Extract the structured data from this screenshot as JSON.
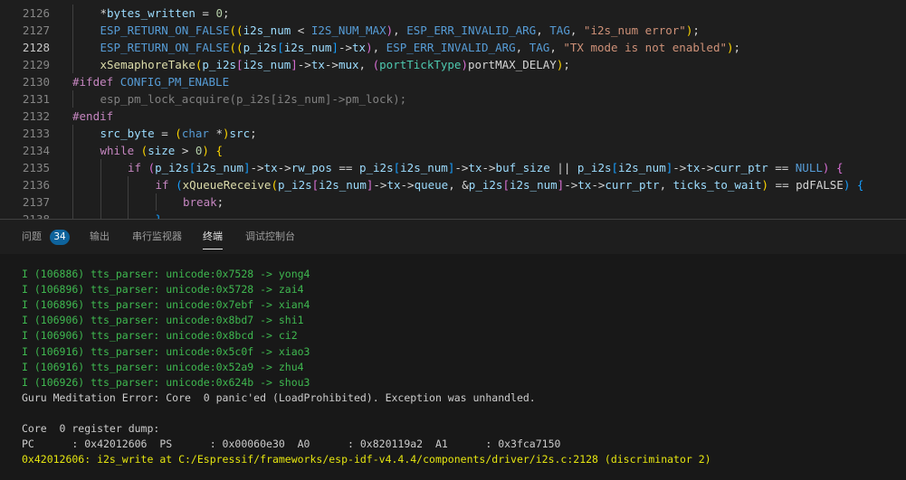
{
  "colors": {
    "background": "#1e1e1e",
    "terminal_background": "#181818",
    "badge": "#0e639c",
    "log_info": "#3fb950",
    "backtrace": "#e5e510"
  },
  "editor": {
    "active_line": "2128",
    "lines": [
      {
        "number": "2126",
        "indent": 1,
        "tokens": [
          {
            "t": "*",
            "c": "txt"
          },
          {
            "t": "bytes_written",
            "c": "var"
          },
          {
            "t": " = ",
            "c": "txt"
          },
          {
            "t": "0",
            "c": "num"
          },
          {
            "t": ";",
            "c": "txt"
          }
        ]
      },
      {
        "number": "2127",
        "indent": 1,
        "tokens": [
          {
            "t": "ESP_RETURN_ON_FALSE",
            "c": "mac"
          },
          {
            "t": "((",
            "c": "br1"
          },
          {
            "t": "i2s_num",
            "c": "var"
          },
          {
            "t": " < ",
            "c": "txt"
          },
          {
            "t": "I2S_NUM_MAX",
            "c": "mac"
          },
          {
            "t": ")",
            "c": "br2"
          },
          {
            "t": ", ",
            "c": "txt"
          },
          {
            "t": "ESP_ERR_INVALID_ARG",
            "c": "mac"
          },
          {
            "t": ", ",
            "c": "txt"
          },
          {
            "t": "TAG",
            "c": "mac"
          },
          {
            "t": ", ",
            "c": "txt"
          },
          {
            "t": "\"i2s_num error\"",
            "c": "str"
          },
          {
            "t": ")",
            "c": "br1"
          },
          {
            "t": ";",
            "c": "txt"
          }
        ]
      },
      {
        "number": "2128",
        "indent": 1,
        "tokens": [
          {
            "t": "ESP_RETURN_ON_FALSE",
            "c": "mac"
          },
          {
            "t": "((",
            "c": "br1"
          },
          {
            "t": "p_i2s",
            "c": "var"
          },
          {
            "t": "[",
            "c": "br3"
          },
          {
            "t": "i2s_num",
            "c": "var"
          },
          {
            "t": "]",
            "c": "br3"
          },
          {
            "t": "->",
            "c": "txt"
          },
          {
            "t": "tx",
            "c": "var"
          },
          {
            "t": ")",
            "c": "br2"
          },
          {
            "t": ", ",
            "c": "txt"
          },
          {
            "t": "ESP_ERR_INVALID_ARG",
            "c": "mac"
          },
          {
            "t": ", ",
            "c": "txt"
          },
          {
            "t": "TAG",
            "c": "mac"
          },
          {
            "t": ", ",
            "c": "txt"
          },
          {
            "t": "\"TX mode is not enabled\"",
            "c": "str"
          },
          {
            "t": ")",
            "c": "br1"
          },
          {
            "t": ";",
            "c": "txt"
          }
        ]
      },
      {
        "number": "2129",
        "indent": 1,
        "tokens": [
          {
            "t": "xSemaphoreTake",
            "c": "fn"
          },
          {
            "t": "(",
            "c": "br1"
          },
          {
            "t": "p_i2s",
            "c": "var"
          },
          {
            "t": "[",
            "c": "br2"
          },
          {
            "t": "i2s_num",
            "c": "var"
          },
          {
            "t": "]",
            "c": "br2"
          },
          {
            "t": "->",
            "c": "txt"
          },
          {
            "t": "tx",
            "c": "var"
          },
          {
            "t": "->",
            "c": "txt"
          },
          {
            "t": "mux",
            "c": "var"
          },
          {
            "t": ", ",
            "c": "txt"
          },
          {
            "t": "(",
            "c": "br2"
          },
          {
            "t": "portTickType",
            "c": "type"
          },
          {
            "t": ")",
            "c": "br2"
          },
          {
            "t": "portMAX_DELAY",
            "c": "txt"
          },
          {
            "t": ")",
            "c": "br1"
          },
          {
            "t": ";",
            "c": "txt"
          }
        ]
      },
      {
        "number": "2130",
        "indent": 0,
        "tokens": [
          {
            "t": "#ifdef",
            "c": "kw"
          },
          {
            "t": " ",
            "c": "txt"
          },
          {
            "t": "CONFIG_PM_ENABLE",
            "c": "mac"
          }
        ]
      },
      {
        "number": "2131",
        "indent": 1,
        "tokens": [
          {
            "t": "esp_pm_lock_acquire(p_i2s[i2s_num]->pm_lock);",
            "c": "dim"
          }
        ]
      },
      {
        "number": "2132",
        "indent": 0,
        "tokens": [
          {
            "t": "#endif",
            "c": "kw"
          }
        ]
      },
      {
        "number": "2133",
        "indent": 1,
        "tokens": [
          {
            "t": "src_byte",
            "c": "var"
          },
          {
            "t": " = ",
            "c": "txt"
          },
          {
            "t": "(",
            "c": "br1"
          },
          {
            "t": "char",
            "c": "kw2"
          },
          {
            "t": " *",
            "c": "txt"
          },
          {
            "t": ")",
            "c": "br1"
          },
          {
            "t": "src",
            "c": "var"
          },
          {
            "t": ";",
            "c": "txt"
          }
        ]
      },
      {
        "number": "2134",
        "indent": 1,
        "tokens": [
          {
            "t": "while",
            "c": "kw"
          },
          {
            "t": " ",
            "c": "txt"
          },
          {
            "t": "(",
            "c": "br1"
          },
          {
            "t": "size",
            "c": "var"
          },
          {
            "t": " > ",
            "c": "txt"
          },
          {
            "t": "0",
            "c": "num"
          },
          {
            "t": ")",
            "c": "br1"
          },
          {
            "t": " ",
            "c": "txt"
          },
          {
            "t": "{",
            "c": "br1"
          }
        ]
      },
      {
        "number": "2135",
        "indent": 2,
        "tokens": [
          {
            "t": "if",
            "c": "kw"
          },
          {
            "t": " ",
            "c": "txt"
          },
          {
            "t": "(",
            "c": "br2"
          },
          {
            "t": "p_i2s",
            "c": "var"
          },
          {
            "t": "[",
            "c": "br3"
          },
          {
            "t": "i2s_num",
            "c": "var"
          },
          {
            "t": "]",
            "c": "br3"
          },
          {
            "t": "->",
            "c": "txt"
          },
          {
            "t": "tx",
            "c": "var"
          },
          {
            "t": "->",
            "c": "txt"
          },
          {
            "t": "rw_pos",
            "c": "var"
          },
          {
            "t": " == ",
            "c": "txt"
          },
          {
            "t": "p_i2s",
            "c": "var"
          },
          {
            "t": "[",
            "c": "br3"
          },
          {
            "t": "i2s_num",
            "c": "var"
          },
          {
            "t": "]",
            "c": "br3"
          },
          {
            "t": "->",
            "c": "txt"
          },
          {
            "t": "tx",
            "c": "var"
          },
          {
            "t": "->",
            "c": "txt"
          },
          {
            "t": "buf_size",
            "c": "var"
          },
          {
            "t": " || ",
            "c": "txt"
          },
          {
            "t": "p_i2s",
            "c": "var"
          },
          {
            "t": "[",
            "c": "br3"
          },
          {
            "t": "i2s_num",
            "c": "var"
          },
          {
            "t": "]",
            "c": "br3"
          },
          {
            "t": "->",
            "c": "txt"
          },
          {
            "t": "tx",
            "c": "var"
          },
          {
            "t": "->",
            "c": "txt"
          },
          {
            "t": "curr_ptr",
            "c": "var"
          },
          {
            "t": " == ",
            "c": "txt"
          },
          {
            "t": "NULL",
            "c": "mac"
          },
          {
            "t": ")",
            "c": "br2"
          },
          {
            "t": " ",
            "c": "txt"
          },
          {
            "t": "{",
            "c": "br2"
          }
        ]
      },
      {
        "number": "2136",
        "indent": 3,
        "tokens": [
          {
            "t": "if",
            "c": "kw"
          },
          {
            "t": " ",
            "c": "txt"
          },
          {
            "t": "(",
            "c": "br3"
          },
          {
            "t": "xQueueReceive",
            "c": "fn"
          },
          {
            "t": "(",
            "c": "br1"
          },
          {
            "t": "p_i2s",
            "c": "var"
          },
          {
            "t": "[",
            "c": "br2"
          },
          {
            "t": "i2s_num",
            "c": "var"
          },
          {
            "t": "]",
            "c": "br2"
          },
          {
            "t": "->",
            "c": "txt"
          },
          {
            "t": "tx",
            "c": "var"
          },
          {
            "t": "->",
            "c": "txt"
          },
          {
            "t": "queue",
            "c": "var"
          },
          {
            "t": ", &",
            "c": "txt"
          },
          {
            "t": "p_i2s",
            "c": "var"
          },
          {
            "t": "[",
            "c": "br2"
          },
          {
            "t": "i2s_num",
            "c": "var"
          },
          {
            "t": "]",
            "c": "br2"
          },
          {
            "t": "->",
            "c": "txt"
          },
          {
            "t": "tx",
            "c": "var"
          },
          {
            "t": "->",
            "c": "txt"
          },
          {
            "t": "curr_ptr",
            "c": "var"
          },
          {
            "t": ", ",
            "c": "txt"
          },
          {
            "t": "ticks_to_wait",
            "c": "var"
          },
          {
            "t": ")",
            "c": "br1"
          },
          {
            "t": " == ",
            "c": "txt"
          },
          {
            "t": "pdFALSE",
            "c": "txt"
          },
          {
            "t": ")",
            "c": "br3"
          },
          {
            "t": " ",
            "c": "txt"
          },
          {
            "t": "{",
            "c": "br3"
          }
        ]
      },
      {
        "number": "2137",
        "indent": 4,
        "tokens": [
          {
            "t": "break",
            "c": "kw"
          },
          {
            "t": ";",
            "c": "txt"
          }
        ]
      },
      {
        "number": "2138",
        "indent": 3,
        "tokens": [
          {
            "t": "}",
            "c": "br3"
          }
        ]
      }
    ]
  },
  "panel": {
    "tabs": [
      {
        "label": "问题",
        "active": false
      },
      {
        "label": "输出",
        "active": false
      },
      {
        "label": "串行监视器",
        "active": false
      },
      {
        "label": "终端",
        "active": true
      },
      {
        "label": "调试控制台",
        "active": false
      }
    ],
    "problems_count": "34"
  },
  "terminal": {
    "lines": [
      {
        "text": "I (106886) tts_parser: unicode:0x7528 -> yong4",
        "kind": "green"
      },
      {
        "text": "I (106896) tts_parser: unicode:0x5728 -> zai4",
        "kind": "green"
      },
      {
        "text": "I (106896) tts_parser: unicode:0x7ebf -> xian4",
        "kind": "green"
      },
      {
        "text": "I (106906) tts_parser: unicode:0x8bd7 -> shi1",
        "kind": "green"
      },
      {
        "text": "I (106906) tts_parser: unicode:0x8bcd -> ci2",
        "kind": "green"
      },
      {
        "text": "I (106916) tts_parser: unicode:0x5c0f -> xiao3",
        "kind": "green"
      },
      {
        "text": "I (106916) tts_parser: unicode:0x52a9 -> zhu4",
        "kind": "green"
      },
      {
        "text": "I (106926) tts_parser: unicode:0x624b -> shou3",
        "kind": "green"
      },
      {
        "text": "Guru Meditation Error: Core  0 panic'ed (LoadProhibited). Exception was unhandled.",
        "kind": "white"
      },
      {
        "text": "",
        "kind": "white"
      },
      {
        "text": "Core  0 register dump:",
        "kind": "white"
      },
      {
        "text": "PC      : 0x42012606  PS      : 0x00060e30  A0      : 0x820119a2  A1      : 0x3fca7150",
        "kind": "white"
      },
      {
        "text": "0x42012606: i2s_write at C:/Espressif/frameworks/esp-idf-v4.4.4/components/driver/i2s.c:2128 (discriminator 2)",
        "kind": "yellow"
      }
    ]
  }
}
